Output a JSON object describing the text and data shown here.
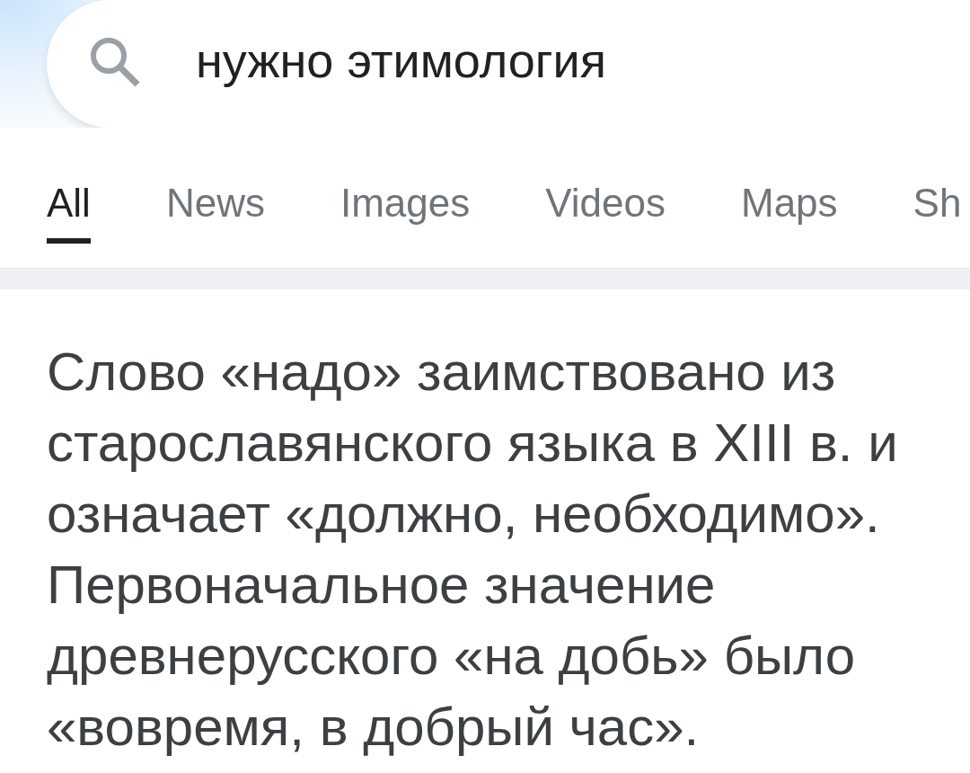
{
  "search": {
    "value": "нужно этимология"
  },
  "tabs": [
    {
      "label": "All",
      "selected": true
    },
    {
      "label": "News",
      "selected": false
    },
    {
      "label": "Images",
      "selected": false
    },
    {
      "label": "Videos",
      "selected": false
    },
    {
      "label": "Maps",
      "selected": false
    },
    {
      "label": "Sh",
      "selected": false
    }
  ],
  "answer": {
    "text": "Слово «надо» заимствовано из старославянского языка в XIII в. и означает «должно, необходимо». Первоначальное значение древнерусского «на добь» было «вовремя, в добрый час»."
  }
}
